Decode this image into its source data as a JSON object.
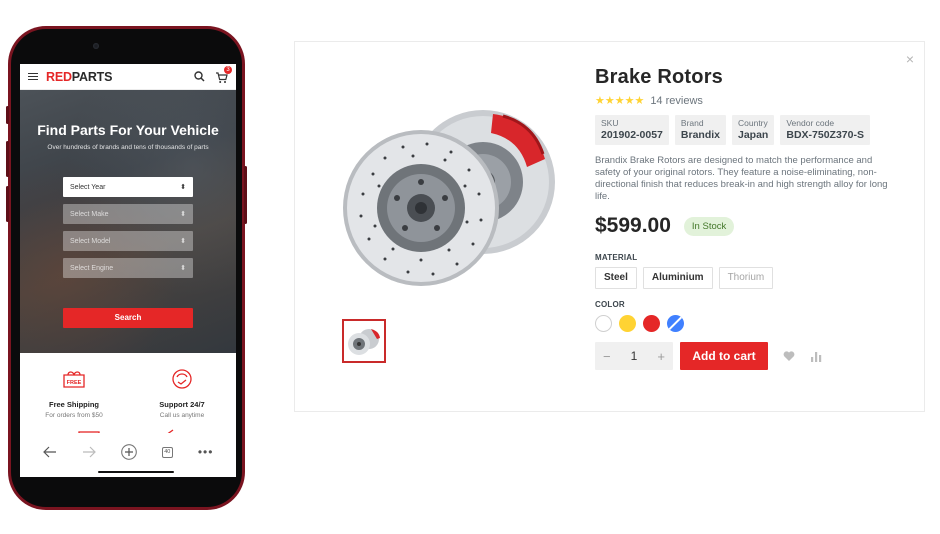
{
  "phone": {
    "header": {
      "logo_red": "RED",
      "logo_dark": "PARTS",
      "cart_count": "3"
    },
    "hero": {
      "title": "Find Parts For Your Vehicle",
      "subtitle": "Over hundreds of brands and tens of thousands of parts",
      "selects": [
        {
          "label": "Select Year",
          "enabled": true
        },
        {
          "label": "Select Make",
          "enabled": false
        },
        {
          "label": "Select Model",
          "enabled": false
        },
        {
          "label": "Select Engine",
          "enabled": false
        }
      ],
      "search_label": "Search"
    },
    "features": [
      {
        "title": "Free Shipping",
        "subtitle": "For orders from $50",
        "icon": "free-shipping-icon",
        "badge": "FREE"
      },
      {
        "title": "Support 24/7",
        "subtitle": "Call us anytime",
        "icon": "support-icon"
      }
    ],
    "browser": {
      "tab_count": "40"
    }
  },
  "product": {
    "title": "Brake Rotors",
    "rating": 5,
    "reviews": "14 reviews",
    "meta": [
      {
        "label": "SKU",
        "value": "201902-0057"
      },
      {
        "label": "Brand",
        "value": "Brandix"
      },
      {
        "label": "Country",
        "value": "Japan"
      },
      {
        "label": "Vendor code",
        "value": "BDX-750Z370-S"
      }
    ],
    "description": "Brandix Brake Rotors are designed to match the performance and safety of your original rotors. They feature a noise-eliminating, non-directional finish that reduces break-in and high strength alloy for long life.",
    "price": "$599.00",
    "stock": "In Stock",
    "material_label": "MATERIAL",
    "materials": [
      {
        "label": "Steel",
        "enabled": true
      },
      {
        "label": "Aluminium",
        "enabled": true
      },
      {
        "label": "Thorium",
        "enabled": false
      }
    ],
    "color_label": "COLOR",
    "colors": [
      "#ffffff",
      "#ffd333",
      "#e52727",
      "#4080ff"
    ],
    "quantity": "1",
    "add_to_cart": "Add to cart",
    "close_symbol": "×"
  },
  "theme": {
    "accent": "#e52727",
    "star": "#ffd333",
    "stock_bg": "#e2f2da"
  }
}
